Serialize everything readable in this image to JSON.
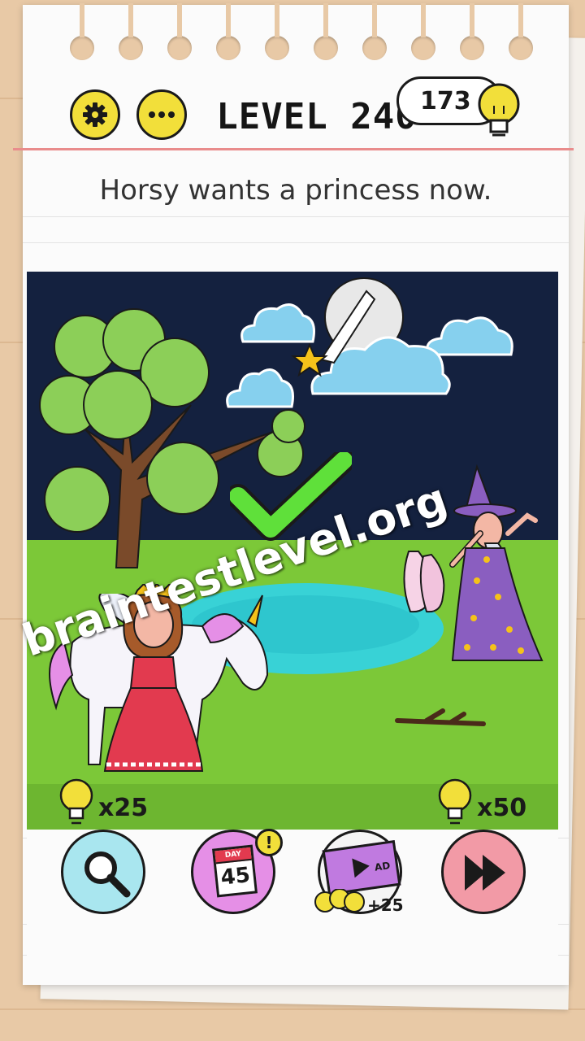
{
  "header": {
    "level_label": "LEVEL 240",
    "hints_count": "173"
  },
  "instruction": "Horsy wants a princess now.",
  "watermark": "braintestlevel.org",
  "tools": {
    "zoom_cost": "x25",
    "skip_cost": "x50",
    "daily_day_label": "DAY",
    "daily_day_number": "45",
    "daily_badge": "!",
    "ad_label": "AD",
    "ad_reward": "+25"
  },
  "colors": {
    "accent_yellow": "#f2df3a",
    "sky": "#14213f",
    "grass": "#7cc838",
    "pond": "#38d2d6",
    "check": "#5fe03a",
    "zoom_button": "#a9e6ef",
    "daily_button": "#e58fe6",
    "ad_button": "#f5f5f5",
    "skip_button": "#f29aa6"
  }
}
